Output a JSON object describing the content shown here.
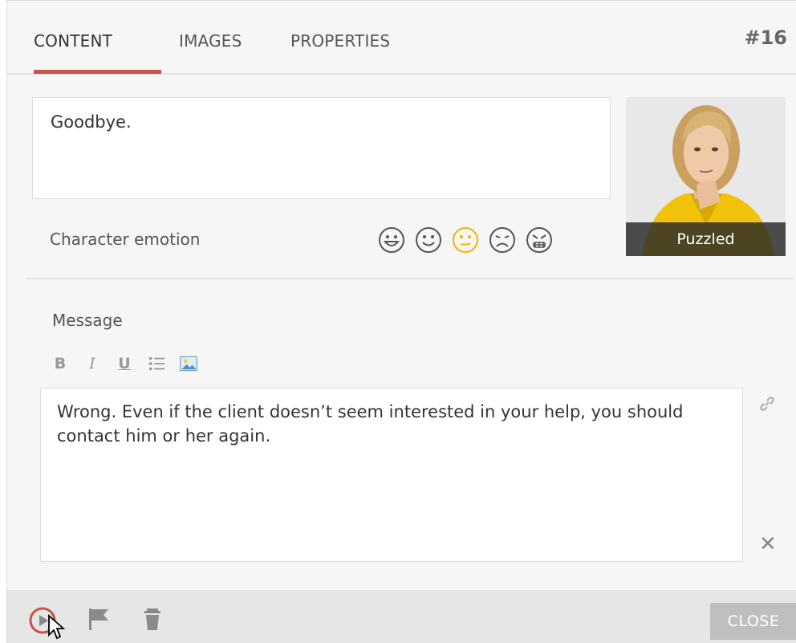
{
  "header": {
    "tabs": [
      {
        "label": "CONTENT"
      },
      {
        "label": "IMAGES"
      },
      {
        "label": "PROPERTIES"
      }
    ],
    "slide_number": "#16"
  },
  "content": {
    "text": "Goodbye.",
    "emotion_label": "Character emotion",
    "emotions": [
      "very-happy-icon",
      "happy-icon",
      "puzzled-icon",
      "sad-icon",
      "angry-icon"
    ],
    "selected_emotion": "puzzled-icon",
    "accent_emotion_color": "#f0b400"
  },
  "character": {
    "caption": "Puzzled"
  },
  "message": {
    "label": "Message",
    "toolbar": {
      "bold": "B",
      "italic": "I",
      "underline": "U"
    },
    "text": "Wrong. Even if the client doesn’t seem interested in your help, you should contact him or her again."
  },
  "footer": {
    "close_label": "CLOSE"
  },
  "colors": {
    "accent": "#c9524b",
    "panel": "#f6f6f6",
    "footer": "#e6e6e6"
  }
}
